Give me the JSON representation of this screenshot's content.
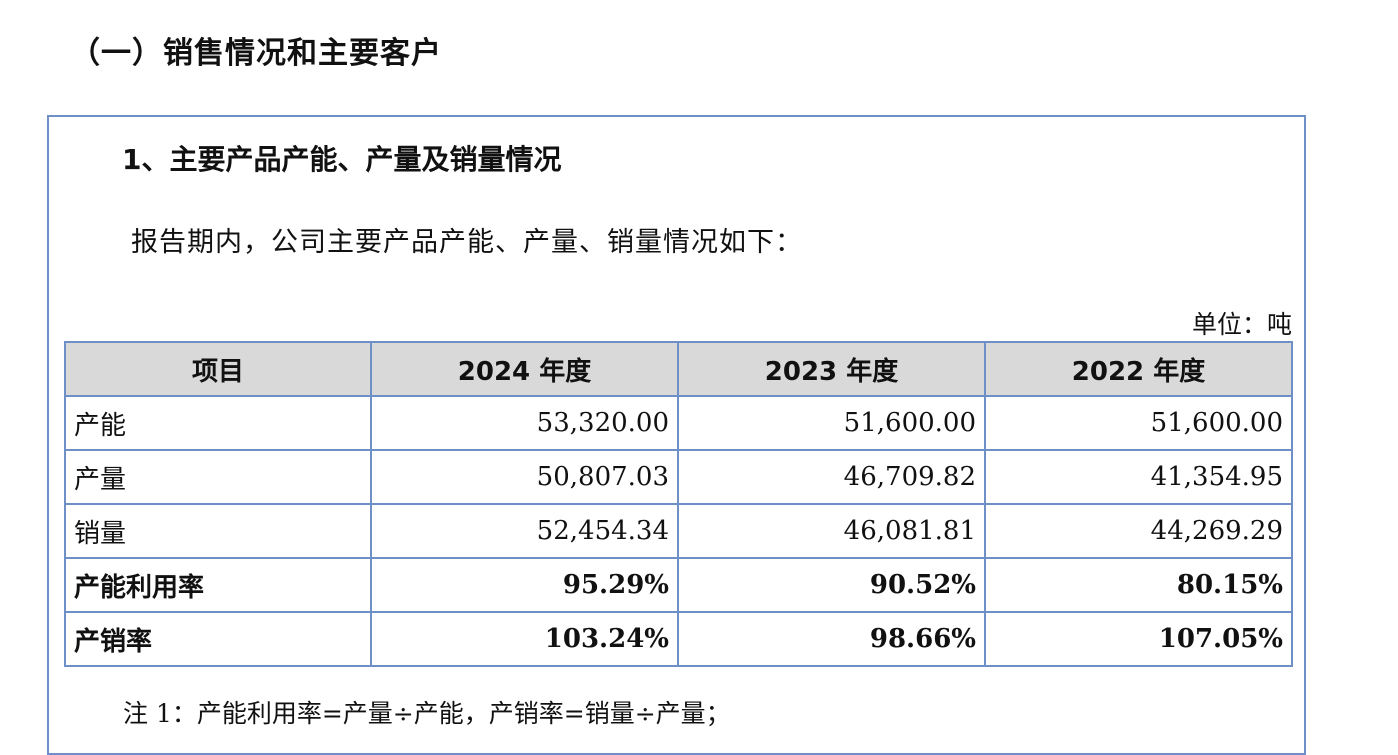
{
  "section_heading": "（一）销售情况和主要客户",
  "sub_heading": "1、主要产品产能、产量及销量情况",
  "intro": "报告期内，公司主要产品产能、产量、销量情况如下：",
  "unit": "单位：吨",
  "table": {
    "headers": [
      "项目",
      "2024 年度",
      "2023 年度",
      "2022 年度"
    ],
    "rows": [
      {
        "label": "产能",
        "values": [
          "53,320.00",
          "51,600.00",
          "51,600.00"
        ],
        "bold": false
      },
      {
        "label": "产量",
        "values": [
          "50,807.03",
          "46,709.82",
          "41,354.95"
        ],
        "bold": false
      },
      {
        "label": "销量",
        "values": [
          "52,454.34",
          "46,081.81",
          "44,269.29"
        ],
        "bold": false
      },
      {
        "label": "产能利用率",
        "values": [
          "95.29%",
          "90.52%",
          "80.15%"
        ],
        "bold": true
      },
      {
        "label": "产销率",
        "values": [
          "103.24%",
          "98.66%",
          "107.05%"
        ],
        "bold": true
      }
    ]
  },
  "note": "注 1：产能利用率=产量÷产能，产销率=销量÷产量；"
}
